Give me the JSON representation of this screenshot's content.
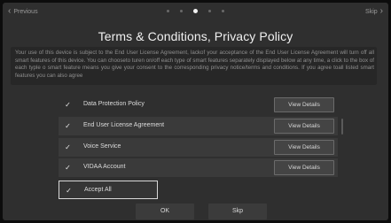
{
  "nav": {
    "previous": "Previous",
    "skip": "Skip"
  },
  "title": "Terms & Conditions, Privacy Policy",
  "terms_text": "Your use of this device is subject to the End User License Agreement, lackof your acceptance of the End User License Agreement will turn off all smart features of this device. You can chooseto turen on/off each type of smart features separately displayed below at any time, a click to the box of each typle o smart feature means you give your consent to the corresponding privacy notice/terms and conditions. If you agree toall listed smart features you can also agree",
  "pagination": {
    "total": 5,
    "active": 2
  },
  "items": [
    {
      "label": "Data Protection Policy",
      "checked": true,
      "button": "View Details"
    },
    {
      "label": "End User License Agreement",
      "checked": true,
      "button": "View Details"
    },
    {
      "label": "Voice Service",
      "checked": true,
      "button": "View Details"
    },
    {
      "label": "VIDAA Account",
      "checked": true,
      "button": "View Details"
    }
  ],
  "accept_all": {
    "label": "Accept All",
    "checked": true
  },
  "buttons": {
    "ok": "OK",
    "skip": "Skp"
  },
  "icons": {
    "prev": "chevron-left-icon",
    "next": "chevron-right-icon",
    "check": "checkmark-icon"
  }
}
